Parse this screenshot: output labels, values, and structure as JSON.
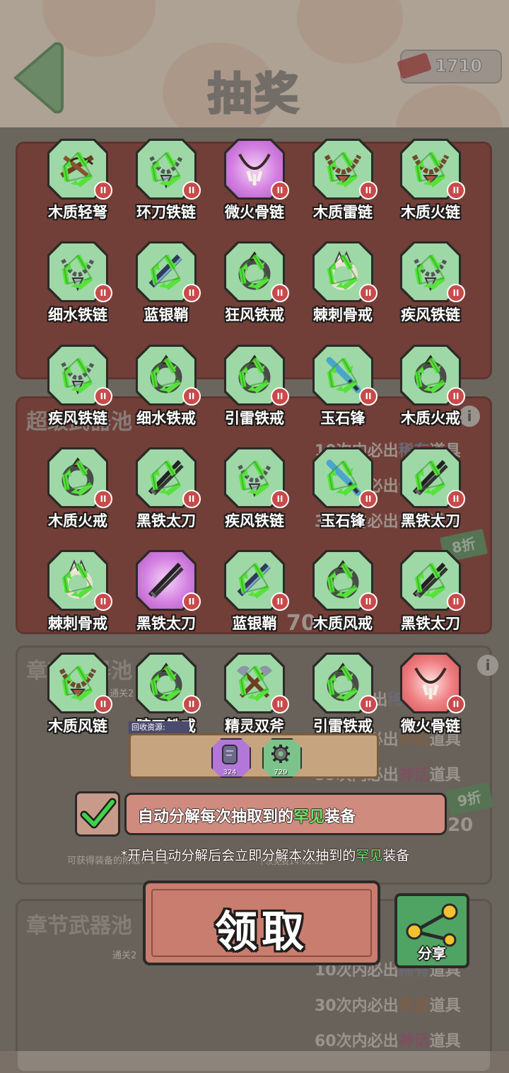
{
  "header": {
    "title": "抽奖",
    "currency_amount": "1710"
  },
  "background": {
    "pool2_title": "超级武器池",
    "pool3_title": "章节武器池",
    "pool4_title": "章节武器池",
    "pool2_guarantees": [
      {
        "prefix": "10次内必出",
        "rarity": "稀有",
        "suffix": "道具"
      },
      {
        "prefix": "30次内必出",
        "rarity": "传说",
        "suffix": "道具"
      },
      {
        "prefix": "30次内必出",
        "rarity": "神话",
        "suffix": "道具"
      }
    ],
    "pool3_guarantees": [
      {
        "prefix": "9次内必出",
        "rarity": "稀有",
        "suffix": "道具"
      },
      {
        "prefix": "29次内必出",
        "rarity": "传说",
        "suffix": "道具"
      },
      {
        "prefix": "59次内必出",
        "rarity": "神话",
        "suffix": "道具"
      }
    ],
    "pool4_guarantees": [
      {
        "prefix": "10次内必出",
        "rarity": "稀有",
        "suffix": "道具"
      },
      {
        "prefix": "30次内必出",
        "rarity": "传说",
        "suffix": "道具"
      },
      {
        "prefix": "60次内必出",
        "rarity": "神话",
        "suffix": "道具"
      }
    ],
    "equip_tier_text": "可获得装备的阶级：1~2",
    "next_free_text": "下次免费14:02:02",
    "discount_1": "8折",
    "discount_2": "9折",
    "price_1": "70",
    "price_2": "720",
    "unlock_text_1": "通关2",
    "unlock_text_2": "通关2"
  },
  "items": [
    {
      "name": "木质轻弩",
      "rarity": "common",
      "badge": "II",
      "icon": "crossbow-icon"
    },
    {
      "name": "环刀铁链",
      "rarity": "common",
      "badge": "II",
      "icon": "chain-necklace-icon"
    },
    {
      "name": "微火骨链",
      "rarity": "epic",
      "badge": "II",
      "icon": "bone-necklace-icon"
    },
    {
      "name": "木质雷链",
      "rarity": "common",
      "badge": "II",
      "icon": "bead-necklace-icon"
    },
    {
      "name": "木质火链",
      "rarity": "common",
      "badge": "II",
      "icon": "bead-necklace-icon"
    },
    {
      "name": "细水铁链",
      "rarity": "common",
      "badge": "II",
      "icon": "chain-necklace-icon"
    },
    {
      "name": "蓝银鞘",
      "rarity": "common",
      "badge": "II",
      "icon": "sheath-icon"
    },
    {
      "name": "狂风铁戒",
      "rarity": "common",
      "badge": "II",
      "icon": "ring-icon"
    },
    {
      "name": "棘刺骨戒",
      "rarity": "common",
      "badge": "II",
      "icon": "bone-ring-icon"
    },
    {
      "name": "疾风铁链",
      "rarity": "common",
      "badge": "II",
      "icon": "chain-necklace-icon"
    },
    {
      "name": "疾风铁链",
      "rarity": "common",
      "badge": "II",
      "icon": "chain-necklace-icon"
    },
    {
      "name": "细水铁戒",
      "rarity": "common",
      "badge": "II",
      "icon": "ring-icon"
    },
    {
      "name": "引雷铁戒",
      "rarity": "common",
      "badge": "II",
      "icon": "ring-icon"
    },
    {
      "name": "玉石锋",
      "rarity": "common",
      "badge": "II",
      "icon": "jade-blade-icon"
    },
    {
      "name": "木质火戒",
      "rarity": "common",
      "badge": "II",
      "icon": "ring-icon"
    },
    {
      "name": "木质火戒",
      "rarity": "common",
      "badge": "II",
      "icon": "ring-icon"
    },
    {
      "name": "黑铁太刀",
      "rarity": "common",
      "badge": "II",
      "icon": "katana-icon"
    },
    {
      "name": "疾风铁链",
      "rarity": "common",
      "badge": "II",
      "icon": "chain-necklace-icon"
    },
    {
      "name": "玉石锋",
      "rarity": "common",
      "badge": "II",
      "icon": "jade-blade-icon"
    },
    {
      "name": "黑铁太刀",
      "rarity": "common",
      "badge": "II",
      "icon": "katana-icon"
    },
    {
      "name": "棘刺骨戒",
      "rarity": "common",
      "badge": "II",
      "icon": "bone-ring-icon"
    },
    {
      "name": "黑铁太刀",
      "rarity": "epic",
      "badge": "II",
      "icon": "katana-icon"
    },
    {
      "name": "蓝银鞘",
      "rarity": "common",
      "badge": "II",
      "icon": "sheath-icon"
    },
    {
      "name": "木质风戒",
      "rarity": "common",
      "badge": "II",
      "icon": "ring-icon"
    },
    {
      "name": "黑铁太刀",
      "rarity": "common",
      "badge": "II",
      "icon": "katana-icon"
    },
    {
      "name": "木质风链",
      "rarity": "common",
      "badge": "II",
      "icon": "bead-necklace-icon"
    },
    {
      "name": "暗刃铁戒",
      "rarity": "common",
      "badge": "II",
      "icon": "ring-icon"
    },
    {
      "name": "精灵双斧",
      "rarity": "common",
      "badge": "II",
      "icon": "double-axe-icon"
    },
    {
      "name": "引雷铁戒",
      "rarity": "common",
      "badge": "II",
      "icon": "ring-icon"
    },
    {
      "name": "微火骨链",
      "rarity": "legendary",
      "badge": "II",
      "icon": "bone-necklace-icon"
    }
  ],
  "recycle": {
    "label": "回收资源:",
    "resources": [
      {
        "amount": "324",
        "icon": "purple-stone-icon",
        "color": "#b277d8"
      },
      {
        "amount": "729",
        "icon": "gear-icon",
        "color": "#7bc38a"
      }
    ]
  },
  "auto_decompose": {
    "checked": true,
    "prefix": "自动分解每次抽取到的",
    "highlight": "罕见",
    "suffix": "装备",
    "note_prefix": "*开启自动分解后会立即分解本次抽到的",
    "note_highlight": "罕见",
    "note_suffix": "装备"
  },
  "buttons": {
    "claim": "领取",
    "share": "分享"
  },
  "colors": {
    "common_tile": "#9ed8a7",
    "epic_tile": "#d481e2",
    "legendary_tile": "#ef7f82",
    "highlight_green": "#6fe36a"
  }
}
